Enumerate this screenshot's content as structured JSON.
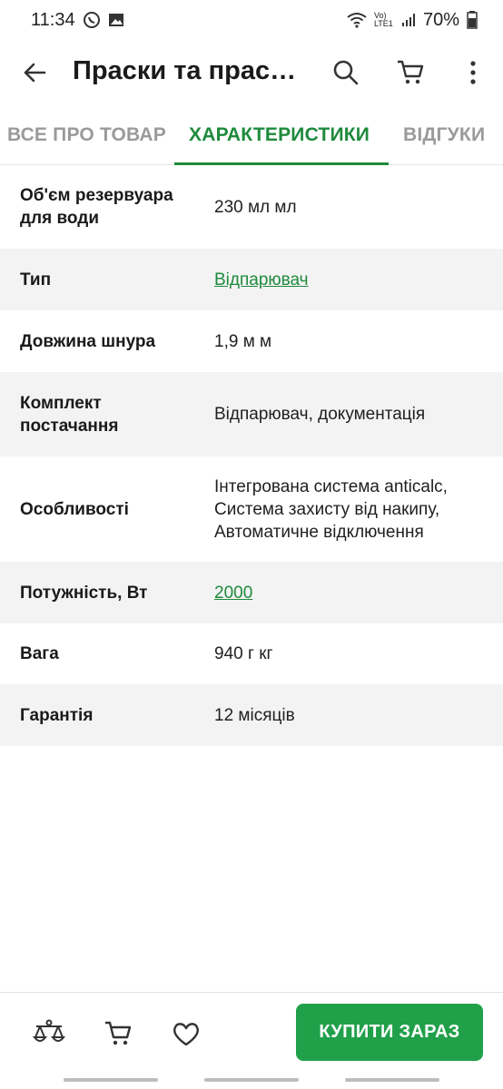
{
  "status_bar": {
    "time": "11:34",
    "battery": "70%",
    "network": "Vo) LTE1"
  },
  "app_bar": {
    "title": "Праски та прасувальні системи",
    "back_icon": "arrow-left-icon",
    "search_icon": "search-icon",
    "cart_icon": "cart-icon",
    "menu_icon": "more-vertical-icon"
  },
  "tabs": [
    {
      "label": "ВСЕ ПРО ТОВАР",
      "active": false
    },
    {
      "label": "ХАРАКТЕРИСТИКИ",
      "active": true
    },
    {
      "label": "ВІДГУКИ",
      "active": false
    }
  ],
  "specs": [
    {
      "label": "Об'єм резервуара для води",
      "value": "230 мл мл",
      "link": false
    },
    {
      "label": "Тип",
      "value": "Відпарювач",
      "link": true
    },
    {
      "label": "Довжина шнура",
      "value": "1,9 м м",
      "link": false
    },
    {
      "label": "Комплект постачання",
      "value": "Відпарювач, документація",
      "link": false
    },
    {
      "label": "Особливості",
      "value": "Інтегрована система anticalc, Система захисту від накипу, Автоматичне відключення",
      "link": false
    },
    {
      "label": "Потужність, Вт",
      "value": "2000",
      "link": true
    },
    {
      "label": "Вага",
      "value": "940 г кг",
      "link": false
    },
    {
      "label": "Гарантія",
      "value": "12 місяців",
      "link": false
    }
  ],
  "bottom_bar": {
    "compare_icon": "compare-scales-icon",
    "cart_icon": "cart-icon",
    "favorite_icon": "heart-icon",
    "buy_label": "КУПИТИ ЗАРАЗ"
  },
  "colors": {
    "accent": "#1e8a3c",
    "buy_button": "#21a04a",
    "row_alt": "#f3f3f3"
  }
}
